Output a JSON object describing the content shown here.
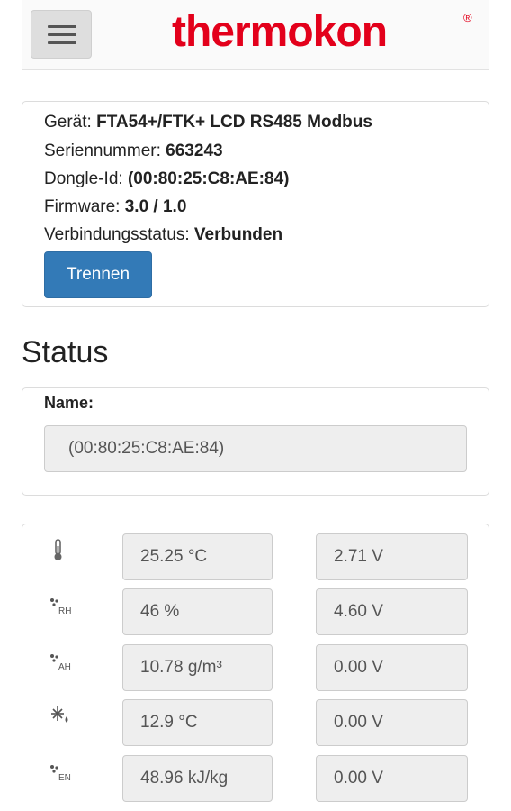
{
  "header": {
    "menu_icon": "hamburger-icon",
    "logo_text": "thermokon",
    "logo_mark": "®",
    "brand_color": "#e3001b"
  },
  "device": {
    "device_label": "Gerät:",
    "device_value": "FTA54+/FTK+ LCD RS485 Modbus",
    "serial_label": "Seriennummer:",
    "serial_value": "663243",
    "dongle_label": "Dongle-Id:",
    "dongle_value": "(00:80:25:C8:AE:84)",
    "firmware_label": "Firmware:",
    "firmware_value": "3.0 / 1.0",
    "status_label": "Verbindungsstatus:",
    "status_value": "Verbunden",
    "disconnect_button": "Trennen",
    "button_color": "#337ab7"
  },
  "status": {
    "title": "Status",
    "name_label": "Name:",
    "name_value": "(00:80:25:C8:AE:84)"
  },
  "measurements": [
    {
      "icon": "thermometer-icon",
      "value": "25.25 °C",
      "voltage": "2.71 V"
    },
    {
      "icon": "relative-humidity-icon",
      "icon_text": "RH",
      "value": "46 %",
      "voltage": "4.60 V"
    },
    {
      "icon": "absolute-humidity-icon",
      "icon_text": "AH",
      "value": "10.78 g/m³",
      "voltage": "0.00 V"
    },
    {
      "icon": "dew-point-icon",
      "value": "12.9 °C",
      "voltage": "0.00 V"
    },
    {
      "icon": "enthalpy-icon",
      "icon_text": "EN",
      "value": "48.96 kJ/kg",
      "voltage": "0.00 V"
    }
  ]
}
